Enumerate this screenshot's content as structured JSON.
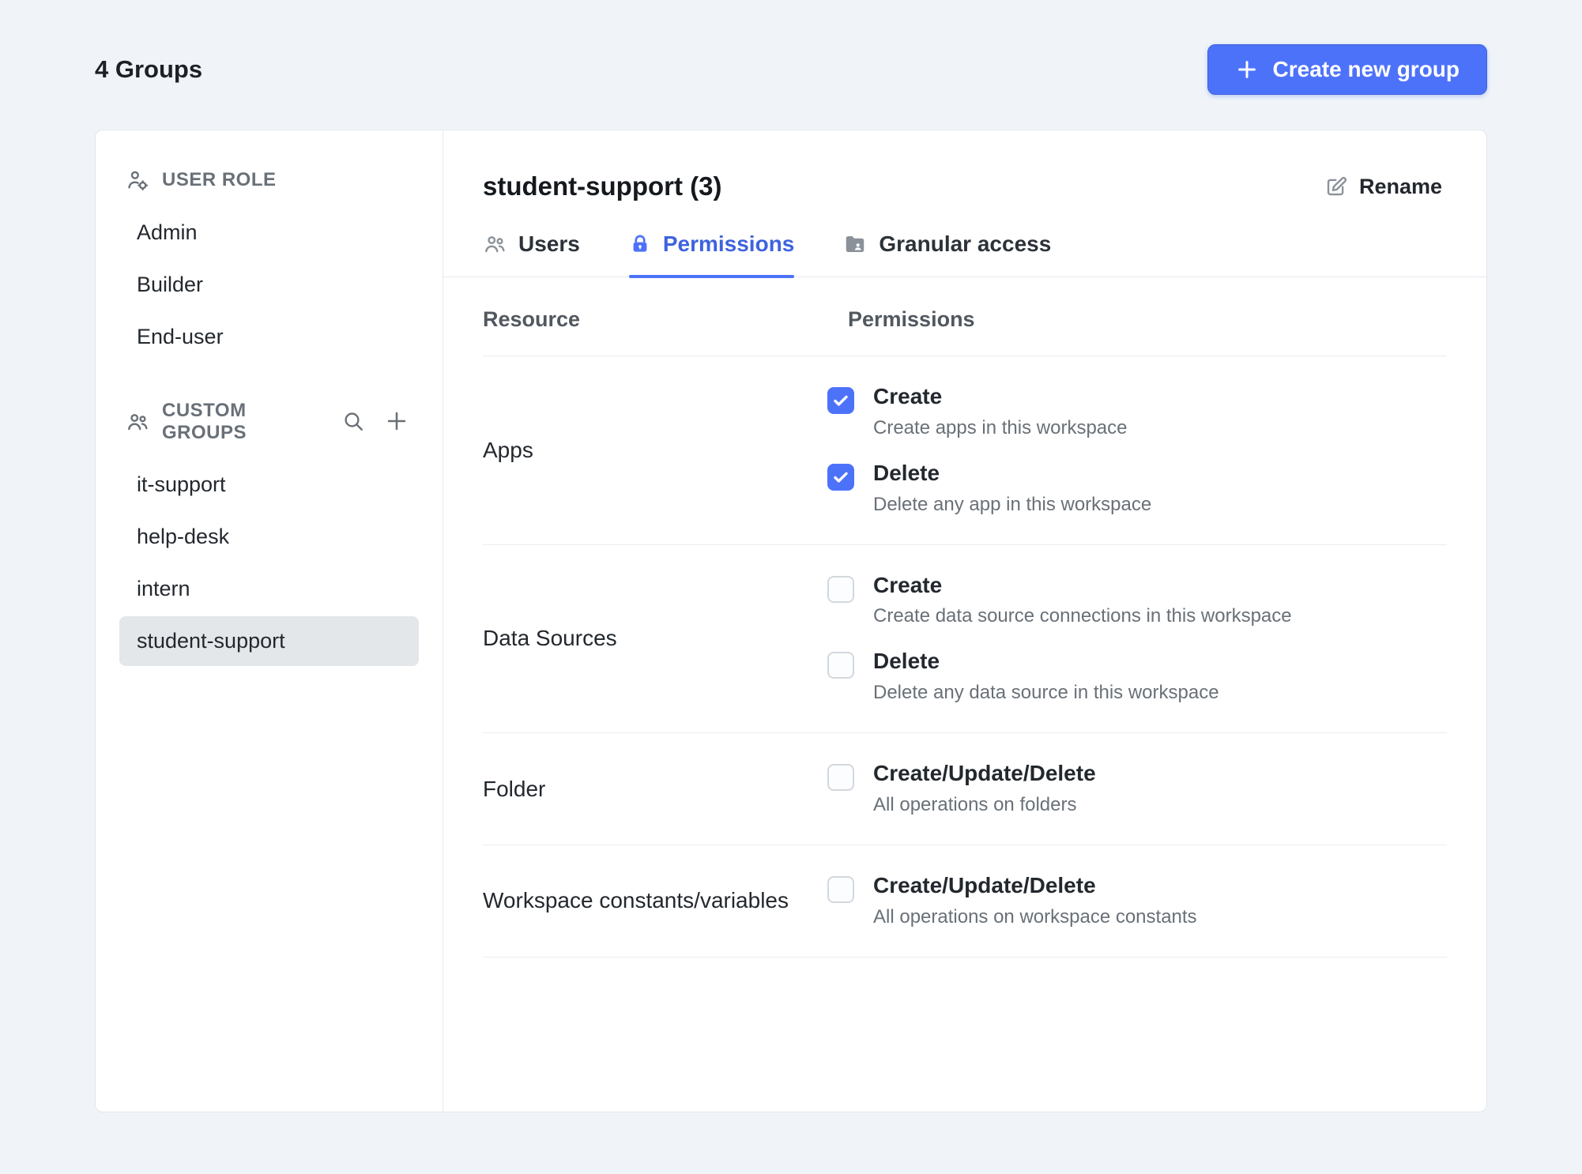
{
  "colors": {
    "accent": "#4d72fa",
    "active_tab_text": "#3e63dd",
    "selected_item_bg": "#e4e7ea"
  },
  "icons": {
    "plus": "+",
    "user_role": "person-with-gear",
    "custom_groups": "people-group",
    "search": "magnifier",
    "users_tab": "people-group",
    "permissions_tab": "lock",
    "granular_tab": "folder",
    "rename": "pencil",
    "checkbox_check": "checkmark"
  },
  "header": {
    "title": "4 Groups",
    "create_button_label": "Create new group"
  },
  "sidebar": {
    "user_role": {
      "label": "USER ROLE",
      "items": [
        {
          "label": "Admin",
          "selected": false
        },
        {
          "label": "Builder",
          "selected": false
        },
        {
          "label": "End-user",
          "selected": false
        }
      ]
    },
    "custom_groups": {
      "label": "CUSTOM GROUPS",
      "items": [
        {
          "label": "it-support",
          "selected": false
        },
        {
          "label": "help-desk",
          "selected": false
        },
        {
          "label": "intern",
          "selected": false
        },
        {
          "label": "student-support",
          "selected": true
        }
      ]
    }
  },
  "main": {
    "title": "student-support (3)",
    "rename_label": "Rename",
    "tabs": [
      {
        "label": "Users",
        "active": false
      },
      {
        "label": "Permissions",
        "active": true
      },
      {
        "label": "Granular access",
        "active": false
      }
    ],
    "table": {
      "headers": {
        "resource": "Resource",
        "permissions": "Permissions"
      },
      "rows": [
        {
          "resource": "Apps",
          "permissions": [
            {
              "label": "Create",
              "description": "Create apps in this workspace",
              "checked": true
            },
            {
              "label": "Delete",
              "description": "Delete any app in this workspace",
              "checked": true
            }
          ]
        },
        {
          "resource": "Data Sources",
          "permissions": [
            {
              "label": "Create",
              "description": "Create data source connections in this workspace",
              "checked": false
            },
            {
              "label": "Delete",
              "description": "Delete any data source in this workspace",
              "checked": false
            }
          ]
        },
        {
          "resource": "Folder",
          "permissions": [
            {
              "label": "Create/Update/Delete",
              "description": "All operations on folders",
              "checked": false
            }
          ]
        },
        {
          "resource": "Workspace constants/variables",
          "permissions": [
            {
              "label": "Create/Update/Delete",
              "description": "All operations on workspace constants",
              "checked": false
            }
          ]
        }
      ]
    }
  }
}
